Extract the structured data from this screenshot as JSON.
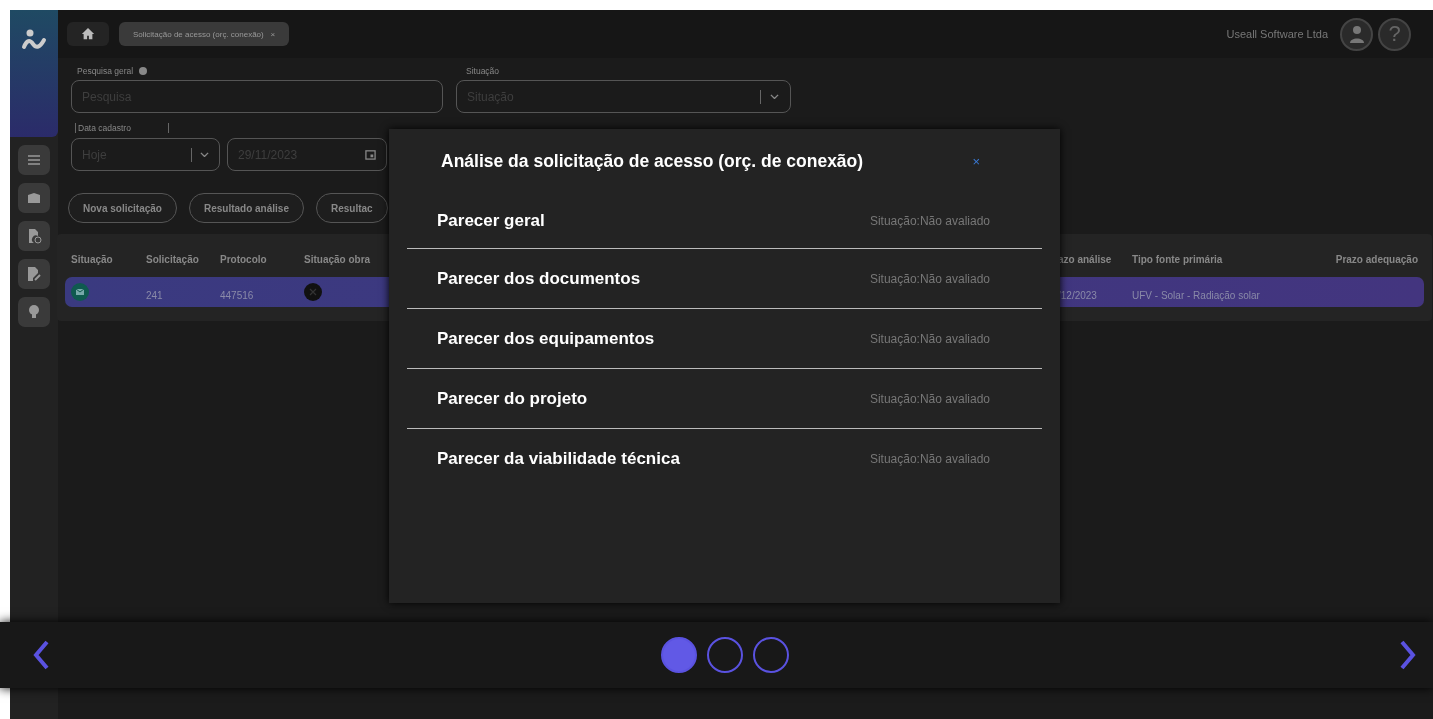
{
  "header": {
    "tab": {
      "label": "Solicitação de acesso (orç. conexão)",
      "close": "×"
    },
    "company": "Useall Software Ltda",
    "help": "?"
  },
  "filters": {
    "search": {
      "label": "Pesquisa geral",
      "placeholder": "Pesquisa"
    },
    "status": {
      "label": "Situação",
      "placeholder": "Situação"
    },
    "date": {
      "label": "Data cadastro",
      "period": "Hoje",
      "date": "29/11/2023"
    }
  },
  "actions": [
    "Nova solicitação",
    "Resultado análise",
    "Resultac"
  ],
  "table": {
    "columns": [
      "Situação",
      "Solicitação",
      "Protocolo",
      "Situação obra",
      "azo análise",
      "Tipo fonte primária",
      "Prazo adequação"
    ],
    "rows": [
      {
        "selected": true,
        "cells": [
          {
            "kind": "mail"
          },
          {
            "kind": "text",
            "text": "241"
          },
          {
            "kind": "text",
            "text": "447516"
          },
          {
            "kind": "cross"
          },
          {
            "kind": "text",
            "text": "/12/2023"
          },
          {
            "kind": "text",
            "text": "UFV - Solar - Radiação solar"
          }
        ]
      }
    ]
  },
  "modal": {
    "title": "Análise da solicitação de acesso (orç. de conexão)",
    "close": "×",
    "items": [
      {
        "label": "Parecer geral",
        "status": "Situação:Não avaliado"
      },
      {
        "label": "Parecer dos documentos",
        "status": "Situação:Não avaliado"
      },
      {
        "label": "Parecer dos equipamentos",
        "status": "Situação:Não avaliado"
      },
      {
        "label": "Parecer do projeto",
        "status": "Situação:Não avaliado"
      },
      {
        "label": "Parecer da viabilidade técnica",
        "status": "Situação:Não avaliado"
      }
    ]
  },
  "carousel": {
    "pages": [
      {
        "selected": true
      },
      {
        "selected": false
      },
      {
        "selected": false
      }
    ]
  }
}
